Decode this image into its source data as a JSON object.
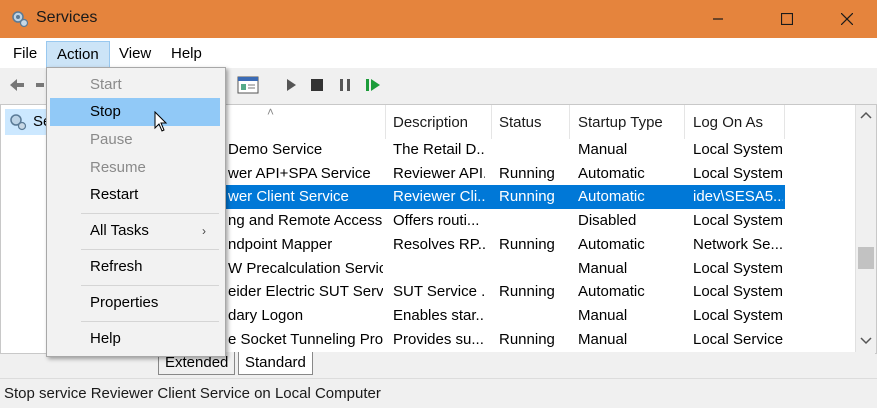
{
  "window": {
    "title": "Services"
  },
  "menubar": {
    "items": [
      "File",
      "Action",
      "View",
      "Help"
    ]
  },
  "action_menu": {
    "start": "Start",
    "stop": "Stop",
    "pause": "Pause",
    "resume": "Resume",
    "restart": "Restart",
    "all_tasks": "All Tasks",
    "refresh": "Refresh",
    "properties": "Properties",
    "help": "Help"
  },
  "tree": {
    "selected_label": "Se"
  },
  "columns": [
    "Description",
    "Status",
    "Startup Type",
    "Log On As"
  ],
  "services": [
    {
      "name": "Demo Service",
      "description": "The Retail D...",
      "status": "",
      "startup": "Manual",
      "logon": "Local System",
      "selected": false
    },
    {
      "name": "wer API+SPA Service",
      "description": "Reviewer API...",
      "status": "Running",
      "startup": "Automatic",
      "logon": "Local System",
      "selected": false
    },
    {
      "name": "wer Client Service",
      "description": "Reviewer Cli...",
      "status": "Running",
      "startup": "Automatic",
      "logon": "idev\\SESA5...",
      "selected": true
    },
    {
      "name": "ng and Remote Access",
      "description": "Offers routi...",
      "status": "",
      "startup": "Disabled",
      "logon": "Local System",
      "selected": false
    },
    {
      "name": "ndpoint Mapper",
      "description": "Resolves RP...",
      "status": "Running",
      "startup": "Automatic",
      "logon": "Network Se...",
      "selected": false
    },
    {
      "name": "W Precalculation Servic...",
      "description": "",
      "status": "",
      "startup": "Manual",
      "logon": "Local System",
      "selected": false
    },
    {
      "name": "eider Electric SUT Service",
      "description": "SUT Service ...",
      "status": "Running",
      "startup": "Automatic",
      "logon": "Local System",
      "selected": false
    },
    {
      "name": "dary Logon",
      "description": "Enables star...",
      "status": "",
      "startup": "Manual",
      "logon": "Local System",
      "selected": false
    },
    {
      "name": "e Socket Tunneling Pro...",
      "description": "Provides su...",
      "status": "Running",
      "startup": "Manual",
      "logon": "Local Service",
      "selected": false
    }
  ],
  "tabs": [
    "Extended",
    "Standard"
  ],
  "status_bar": "Stop service Reviewer Client Service on Local Computer",
  "colors": {
    "titlebar": "#e5843d",
    "selection": "#0078d7",
    "menu_hover": "#91c9f7"
  }
}
